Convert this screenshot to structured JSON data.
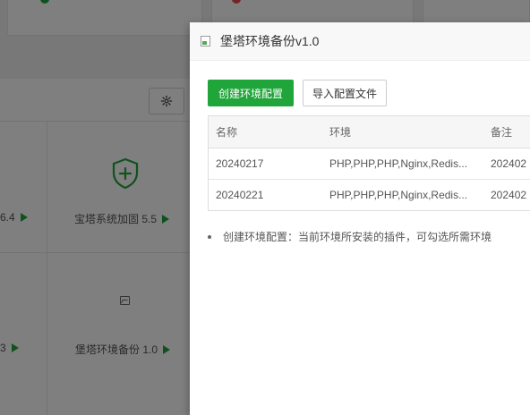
{
  "background": {
    "tiles": [
      {
        "label": "6.4"
      },
      {
        "label": "宝塔系统加固 5.5"
      },
      {
        "label": "3"
      },
      {
        "label": "堡塔环境备份 1.0"
      }
    ]
  },
  "dialog": {
    "title": "堡塔环境备份v1.0",
    "buttons": {
      "create": "创建环境配置",
      "import": "导入配置文件"
    },
    "table": {
      "headers": [
        "名称",
        "环境",
        "备注"
      ],
      "rows": [
        [
          "20240217",
          "PHP,PHP,PHP,Nginx,Redis...",
          "202402"
        ],
        [
          "20240221",
          "PHP,PHP,PHP,Nginx,Redis...",
          "202402"
        ]
      ]
    },
    "notes": [
      "创建环境配置：当前环境所安装的插件，可勾选所需环境"
    ]
  },
  "colors": {
    "primary": "#20a53a",
    "overlay": "rgba(0,0,0,0.5)"
  }
}
